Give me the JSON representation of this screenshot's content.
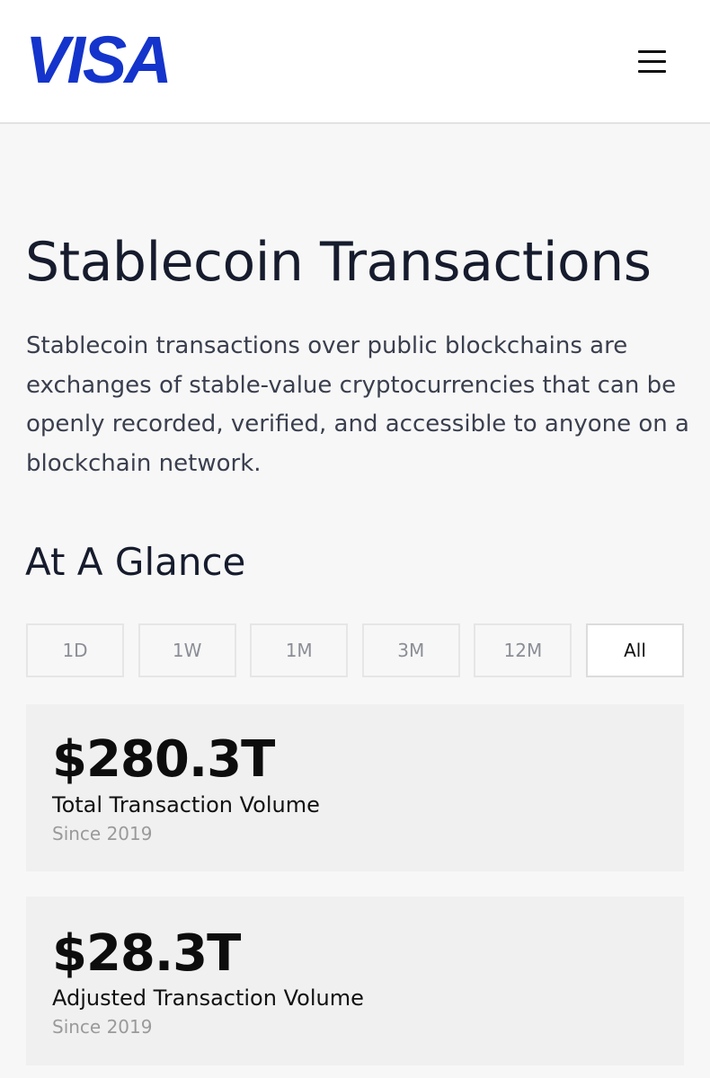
{
  "header": {
    "logo_text": "VISA",
    "brand_color": "#1a1f71",
    "logo_color": "#1434cb",
    "menu_icon": "hamburger-menu-icon"
  },
  "main": {
    "title": "Stablecoin Transactions",
    "description": "Stablecoin transactions over public blockchains are exchanges of stable-value cryptocurrencies that can be openly recorded, verified, and accessible to anyone on a blockchain network.",
    "section_title": "At A Glance",
    "filters": [
      {
        "label": "1D",
        "active": false
      },
      {
        "label": "1W",
        "active": false
      },
      {
        "label": "1M",
        "active": false
      },
      {
        "label": "3M",
        "active": false
      },
      {
        "label": "12M",
        "active": false
      },
      {
        "label": "All",
        "active": true
      }
    ],
    "stats": [
      {
        "value": "$280.3T",
        "label": "Total Transaction Volume",
        "sub": "Since 2019"
      },
      {
        "value": "$28.3T",
        "label": "Adjusted Transaction Volume",
        "sub": "Since 2019"
      }
    ]
  }
}
